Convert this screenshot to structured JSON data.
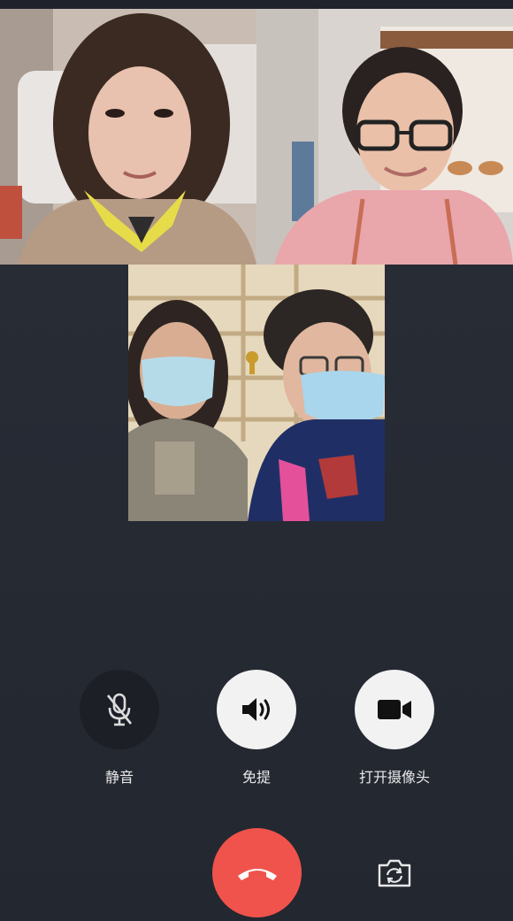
{
  "participants": [
    {
      "id": "participant-1",
      "icon": "video-feed"
    },
    {
      "id": "participant-2",
      "icon": "video-feed"
    },
    {
      "id": "participant-3",
      "icon": "video-feed"
    }
  ],
  "controls": {
    "mute": {
      "label": "静音",
      "icon": "mic-off-icon",
      "active": true
    },
    "speaker": {
      "label": "免提",
      "icon": "speaker-icon"
    },
    "camera": {
      "label": "打开摄像头",
      "icon": "video-camera-icon"
    }
  },
  "bottom": {
    "hangup_icon": "hang-up-icon",
    "flip_icon": "switch-camera-icon"
  },
  "colors": {
    "background": "#262a33",
    "hangup": "#f0534c",
    "button_light": "#f2f2f2",
    "button_dark": "#1c1f26",
    "label": "#e9e9ea"
  }
}
